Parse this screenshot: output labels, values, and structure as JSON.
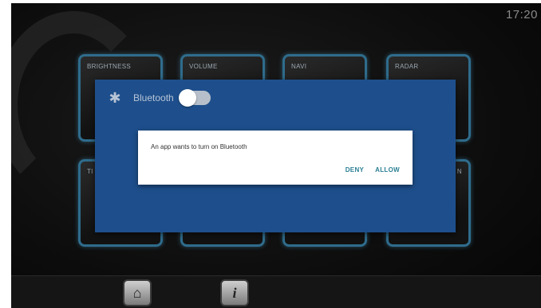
{
  "status_bar": {
    "time": "17:20"
  },
  "tiles": {
    "brightness": "BRIGHTNESS",
    "volume": "VOLUME",
    "navi": "NAVI",
    "radar": "RADAR",
    "row2_left": "TI",
    "row2_right": "N"
  },
  "bluetooth_panel": {
    "icon": "bluetooth-icon",
    "title": "Bluetooth",
    "toggle_state": "off"
  },
  "dialog": {
    "message": "An app wants to turn on Bluetooth",
    "deny_label": "DENY",
    "allow_label": "ALLOW",
    "action_color": "#2a7f93"
  },
  "dock": {
    "home_icon": "home-icon",
    "info_icon": "info-icon"
  },
  "colors": {
    "panel": "#1e4f8c",
    "tile_border": "#2f6c8c"
  }
}
